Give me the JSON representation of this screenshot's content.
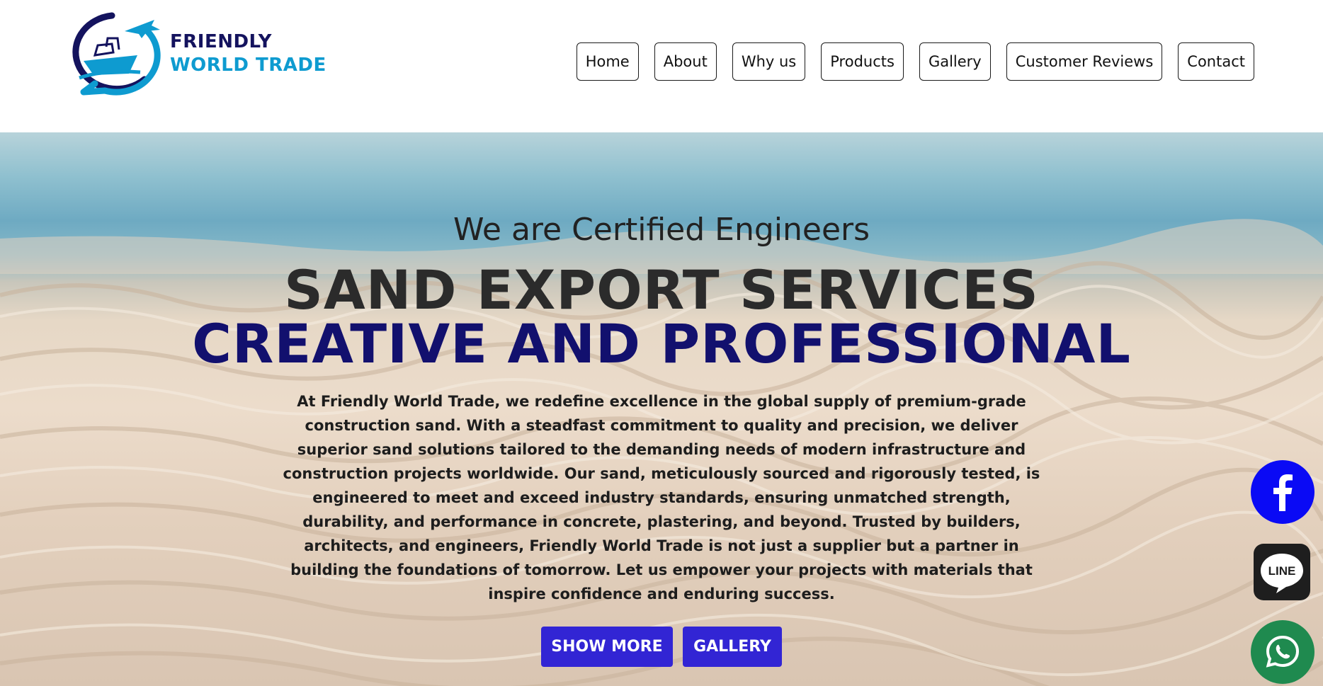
{
  "brand": {
    "line1": "FRIENDLY",
    "line2": "WORLD TRADE",
    "primary_color": "#14135e",
    "secondary_color": "#0e9bd0"
  },
  "nav": {
    "items": [
      {
        "label": "Home"
      },
      {
        "label": "About"
      },
      {
        "label": "Why us"
      },
      {
        "label": "Products"
      },
      {
        "label": "Gallery"
      },
      {
        "label": "Customer Reviews"
      },
      {
        "label": "Contact"
      }
    ]
  },
  "hero": {
    "kicker": "We are Certified Engineers",
    "title_line1": "SAND EXPORT SERVICES",
    "title_line2": "CREATIVE AND PROFESSIONAL",
    "description": "At Friendly World Trade, we redefine excellence in the global supply of premium-grade construction sand. With a steadfast commitment to quality and precision, we deliver superior sand solutions tailored to the demanding needs of modern infrastructure and construction projects worldwide. Our sand, meticulously sourced and rigorously tested, is engineered to meet and exceed industry standards, ensuring unmatched strength, durability, and performance in concrete, plastering, and beyond. Trusted by builders, architects, and engineers, Friendly World Trade is not just a supplier but a partner in building the foundations of tomorrow. Let us empower your projects with materials that inspire confidence and enduring success.",
    "buttons": {
      "show_more": "SHOW MORE",
      "gallery": "GALLERY"
    },
    "button_color": "#3225d4",
    "title_accent_color": "#12106e"
  },
  "social": {
    "facebook": {
      "icon": "facebook-icon",
      "color": "#0a0af5"
    },
    "line": {
      "icon": "line-icon",
      "label": "LINE",
      "color": "#1e1e1e"
    },
    "whatsapp": {
      "icon": "whatsapp-icon",
      "color": "#1f8a4f"
    }
  }
}
